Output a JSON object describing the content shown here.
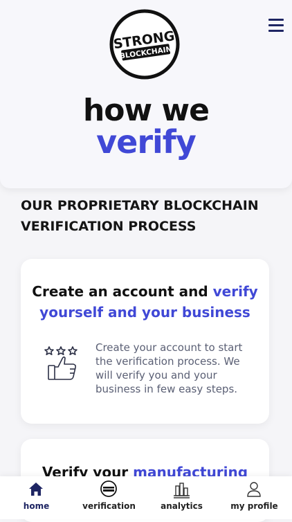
{
  "logo": {
    "line1": "STRONG",
    "line2": "BLOCKCHAIN"
  },
  "hero": {
    "title_line1": "how we",
    "title_line2": "verify"
  },
  "section": {
    "heading": "OUR PROPRIETARY BLOCKCHAIN VERIFICATION PROCESS"
  },
  "cards": [
    {
      "title_plain": "Create an account and ",
      "title_accent": "verify yourself and your business",
      "icon": "rating-thumbs-up-icon",
      "text": "Create your account to start the verification process. We will verify you and your business in few easy steps."
    },
    {
      "title_plain": "Verify your ",
      "title_accent": "manufacturing"
    }
  ],
  "nav": {
    "items": [
      {
        "label": "home",
        "icon": "home-icon"
      },
      {
        "label": "verification",
        "icon": "strong-blockchain-badge-icon"
      },
      {
        "label": "analytics",
        "icon": "analytics-building-icon"
      },
      {
        "label": "my profile",
        "icon": "user-profile-icon"
      }
    ]
  },
  "colors": {
    "accent": "#4048d6",
    "navy": "#1e2563",
    "text": "#111111",
    "muted": "#5a5f74"
  }
}
